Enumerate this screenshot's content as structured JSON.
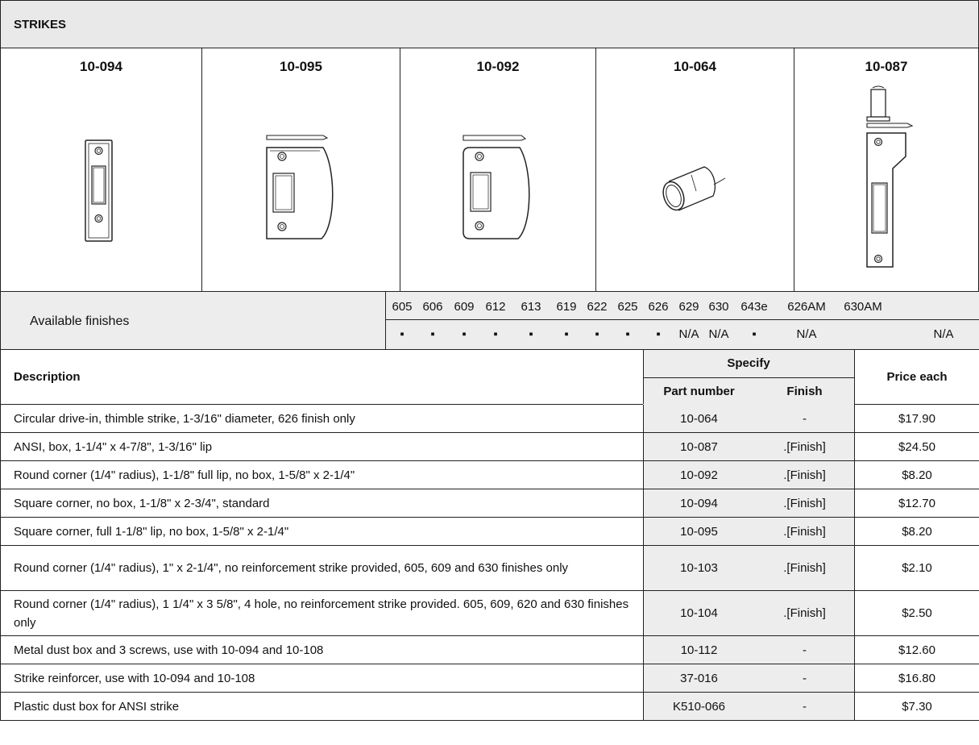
{
  "section_title": "STRIKES",
  "products": [
    {
      "code": "10-094"
    },
    {
      "code": "10-095"
    },
    {
      "code": "10-092"
    },
    {
      "code": "10-064"
    },
    {
      "code": "10-087"
    }
  ],
  "finishes": {
    "label": "Available finishes",
    "codes": [
      "605",
      "606",
      "609",
      "612",
      "613",
      "619",
      "622",
      "625",
      "626",
      "629",
      "630",
      "643e",
      "626AM",
      "630AM"
    ],
    "marks": [
      "▪",
      "▪",
      "▪",
      "▪",
      "▪",
      "▪",
      "▪",
      "▪",
      "▪",
      "N/A",
      "N/A",
      "▪",
      "N/A",
      "N/A"
    ]
  },
  "table": {
    "headers": {
      "description": "Description",
      "specify": "Specify",
      "part_number": "Part number",
      "finish": "Finish",
      "price_each": "Price each"
    },
    "rows": [
      {
        "description": "Circular drive-in, thimble strike, 1-3/16\" diameter, 626 finish only",
        "part": "10-064",
        "finish": "-",
        "price": "$17.90"
      },
      {
        "description": "ANSI, box, 1-1/4\" x 4-7/8\", 1-3/16\" lip",
        "part": "10-087",
        "finish": ".[Finish]",
        "price": "$24.50"
      },
      {
        "description": "Round corner (1/4\" radius), 1-1/8\" full lip, no box, 1-5/8\" x 2-1/4\"",
        "part": "10-092",
        "finish": ".[Finish]",
        "price": "$8.20"
      },
      {
        "description": "Square corner, no box,  1-1/8\" x 2-3/4\", standard",
        "part": "10-094",
        "finish": ".[Finish]",
        "price": "$12.70"
      },
      {
        "description": "Square corner, full 1-1/8\" lip, no box, 1-5/8\" x 2-1/4\"",
        "part": "10-095",
        "finish": ".[Finish]",
        "price": "$8.20"
      },
      {
        "description": "Round corner (1/4\" radius), 1\" x 2-1/4\", no reinforcement strike provided, 605, 609 and 630 finishes only",
        "part": "10-103",
        "finish": ".[Finish]",
        "price": "$2.10"
      },
      {
        "description": "Round corner (1/4\" radius), 1 1/4\" x 3 5/8\", 4 hole, no reinforcement strike provided.  605, 609, 620 and 630 finishes only",
        "part": "10-104",
        "finish": ".[Finish]",
        "price": "$2.50"
      },
      {
        "description": "Metal dust box and 3 screws, use with 10-094 and 10-108",
        "part": "10-112",
        "finish": "-",
        "price": "$12.60"
      },
      {
        "description": "Strike reinforcer, use with 10-094 and 10-108",
        "part": "37-016",
        "finish": "-",
        "price": "$16.80"
      },
      {
        "description": "Plastic dust box for ANSI strike",
        "part": "K510-066",
        "finish": "-",
        "price": "$7.30"
      }
    ]
  }
}
